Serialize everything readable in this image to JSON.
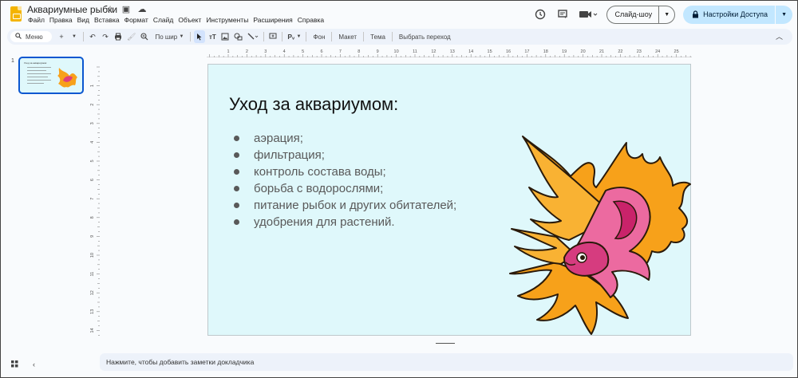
{
  "app": {
    "title": "Аквариумные рыбки",
    "menu": [
      "Файл",
      "Правка",
      "Вид",
      "Вставка",
      "Формат",
      "Слайд",
      "Объект",
      "Инструменты",
      "Расширения",
      "Справка"
    ]
  },
  "header": {
    "slideshow_label": "Слайд-шоу",
    "share_label": "Настройки Доступа"
  },
  "toolbar": {
    "search_label": "Меню",
    "zoom_label": "По шир",
    "background_label": "Фон",
    "layout_label": "Макет",
    "theme_label": "Тема",
    "transition_label": "Выбрать переход"
  },
  "filmstrip": {
    "slide_number": "1"
  },
  "ruler": {
    "horizontal": [
      "1",
      "2",
      "3",
      "4",
      "5",
      "6",
      "7",
      "8",
      "9",
      "10",
      "11",
      "12",
      "13",
      "14",
      "15",
      "16",
      "17",
      "18",
      "19",
      "20",
      "21",
      "22",
      "23",
      "24",
      "25"
    ],
    "vertical": [
      "1",
      "2",
      "3",
      "4",
      "5",
      "6",
      "7",
      "8",
      "9",
      "10",
      "11",
      "12",
      "13",
      "14"
    ]
  },
  "slide": {
    "title": "Уход за аквариумом:",
    "bullets": [
      "аэрация;",
      "фильтрация;",
      "контроль состава воды;",
      "борьба с водорослями;",
      "питание рыбок и других обитателей;",
      "удобрения для растений."
    ],
    "background_color": "#dff8fb"
  },
  "notes": {
    "placeholder": "Нажмите, чтобы добавить заметки докладчика"
  },
  "colors": {
    "accent": "#0b57d0",
    "share_button": "#c2e7ff",
    "fish_orange": "#f7a11a",
    "fish_pink": "#e0407a"
  }
}
